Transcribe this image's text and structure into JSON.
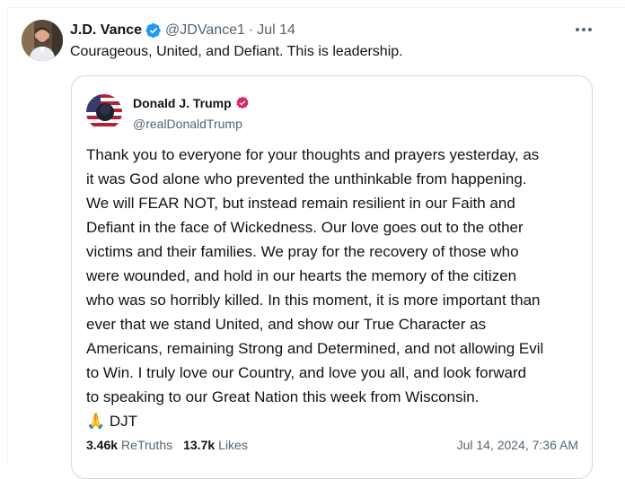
{
  "tweet": {
    "author_name": "J.D. Vance",
    "handle": "@JDVance1",
    "separator": "·",
    "date": "Jul 14",
    "text": "Courageous, United, and Defiant. This is leadership.",
    "more_icon": "more-horizontal-icon",
    "verified_icon": "verified-badge-icon",
    "colors": {
      "verified_blue": "#1d9bf0",
      "muted": "#536471",
      "text": "#0f1419",
      "border": "#cfd9de"
    }
  },
  "quote": {
    "author_name": "Donald J. Trump",
    "handle": "@realDonaldTrump",
    "badge_icon": "verified-badge-icon",
    "badge_color": "#e0245e",
    "lines": [
      "Thank you to everyone for your thoughts and prayers yesterday, as",
      "it was God alone who prevented the unthinkable from happening.",
      "We will FEAR NOT, but instead remain resilient in our Faith and",
      "Defiant in the face of Wickedness. Our love goes out to the other",
      "victims and their families. We pray for the recovery of those who",
      "were wounded, and hold in our hearts the memory of the citizen",
      "who was so horribly killed. In this moment, it is more important than",
      "ever that we stand United, and show our True Character as",
      "Americans, remaining Strong and Determined, and not allowing Evil",
      "to Win. I truly love our Country, and love you all, and look forward",
      "to speaking to our Great Nation this week from Wisconsin."
    ],
    "signoff_emoji": "🙏",
    "signoff": "DJT",
    "retruths_count": "3.46k",
    "retruths_label": "ReTruths",
    "likes_count": "13.7k",
    "likes_label": "Likes",
    "timestamp": "Jul 14, 2024, 7:36 AM"
  }
}
